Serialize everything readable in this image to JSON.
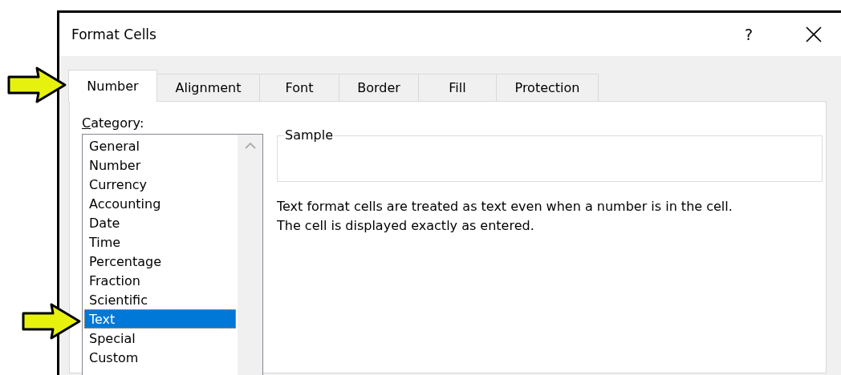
{
  "window": {
    "title": "Format Cells",
    "help_button": "?"
  },
  "tabs": [
    {
      "label": "Number",
      "selected": true
    },
    {
      "label": "Alignment",
      "selected": false
    },
    {
      "label": "Font",
      "selected": false
    },
    {
      "label": "Border",
      "selected": false
    },
    {
      "label": "Fill",
      "selected": false
    },
    {
      "label": "Protection",
      "selected": false
    }
  ],
  "category": {
    "label": {
      "mnemonic": "C",
      "rest": "ategory:"
    },
    "items": [
      {
        "label": "General",
        "selected": false
      },
      {
        "label": "Number",
        "selected": false
      },
      {
        "label": "Currency",
        "selected": false
      },
      {
        "label": "Accounting",
        "selected": false
      },
      {
        "label": "Date",
        "selected": false
      },
      {
        "label": "Time",
        "selected": false
      },
      {
        "label": "Percentage",
        "selected": false
      },
      {
        "label": "Fraction",
        "selected": false
      },
      {
        "label": "Scientific",
        "selected": false
      },
      {
        "label": "Text",
        "selected": true
      },
      {
        "label": "Special",
        "selected": false
      },
      {
        "label": "Custom",
        "selected": false
      }
    ]
  },
  "sample": {
    "title": "Sample"
  },
  "description": [
    "Text format cells are treated as text even when a number is in the cell.",
    "The cell is displayed exactly as entered."
  ]
}
